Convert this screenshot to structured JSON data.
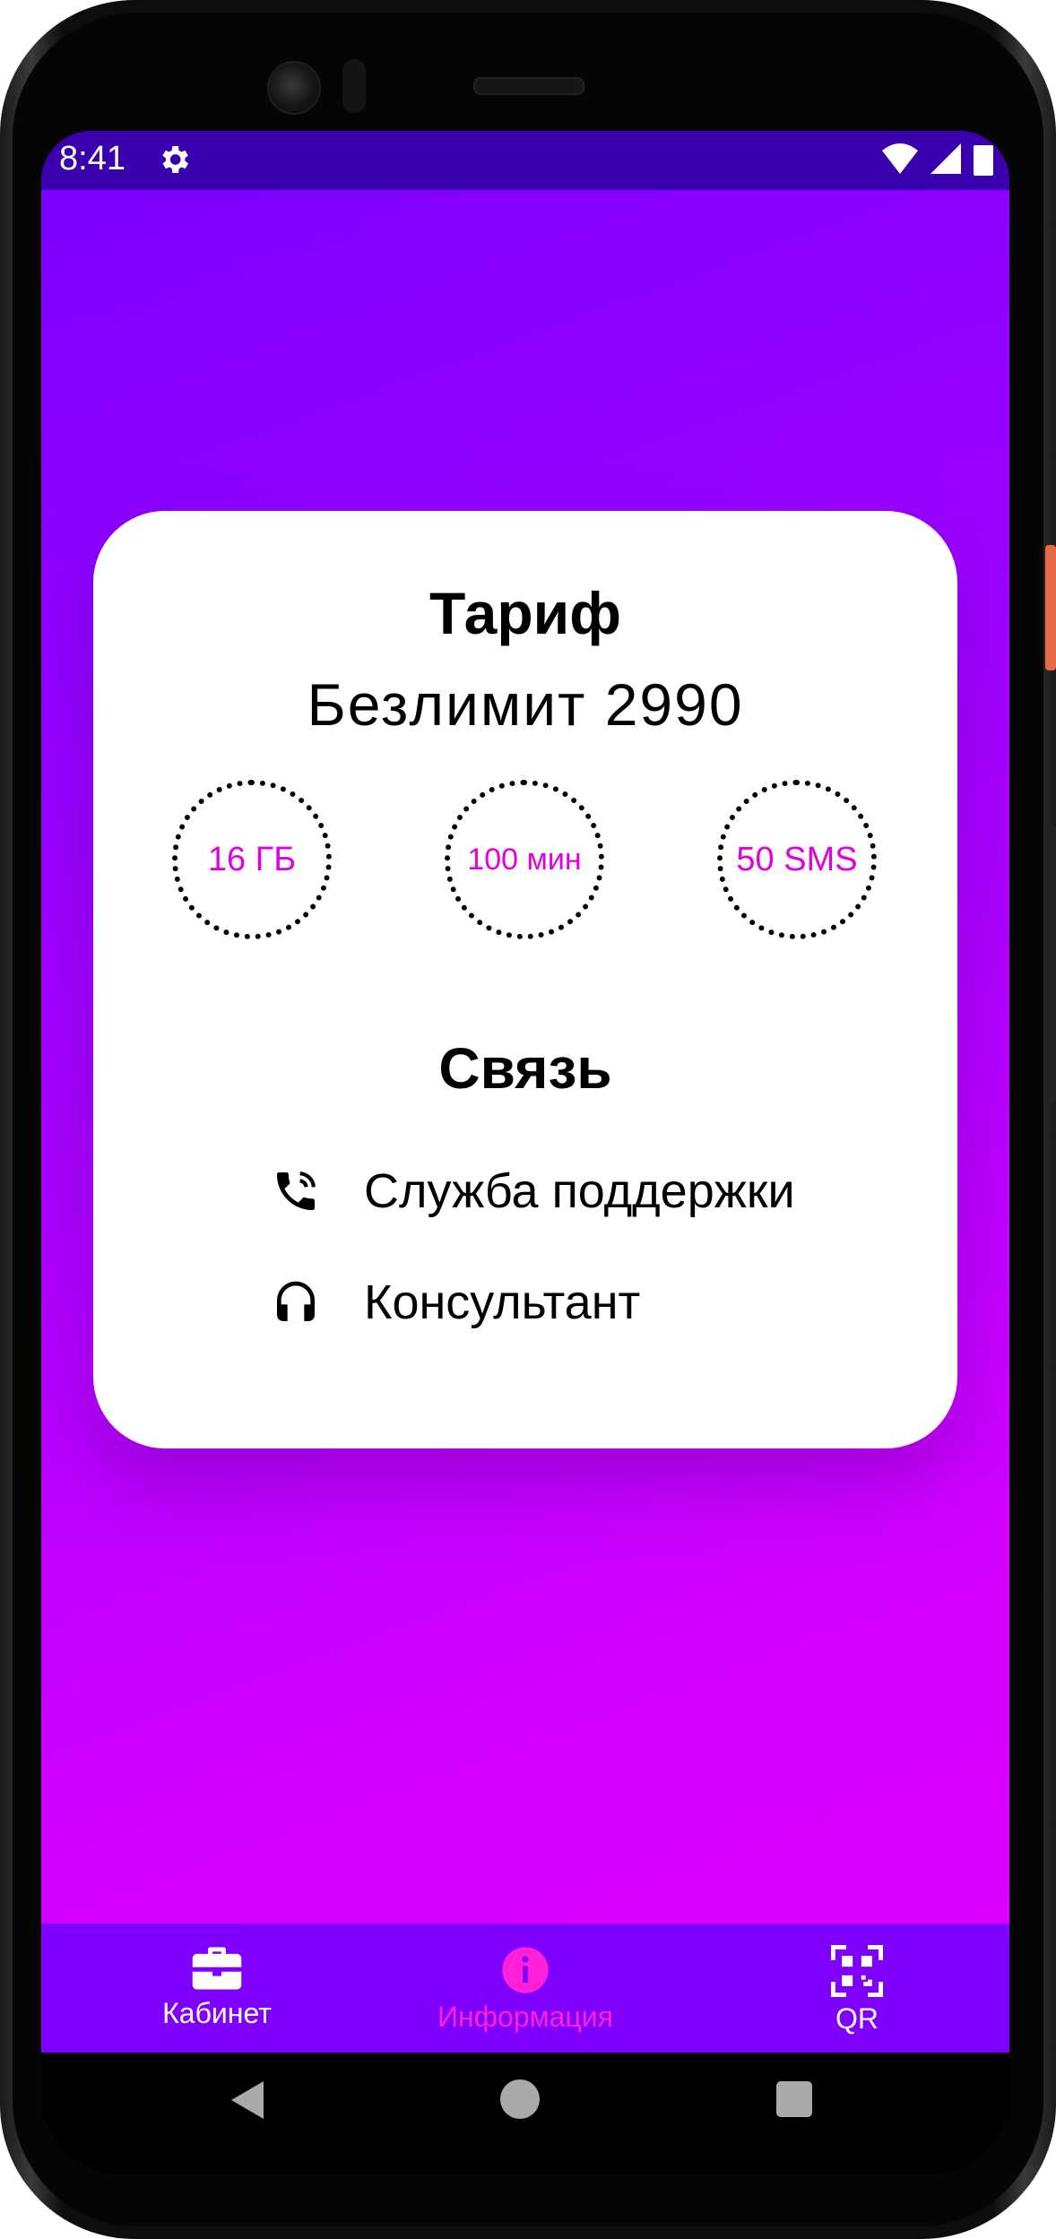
{
  "status_bar": {
    "time": "8:41",
    "icons": [
      "gear-icon",
      "wifi-icon",
      "signal-icon",
      "battery-icon"
    ]
  },
  "card": {
    "title": "Тариф",
    "plan_name": "Безлимит 2990",
    "allowances": [
      "16 ГБ",
      "100 мин",
      "50 SMS"
    ],
    "section_title": "Связь",
    "links": [
      {
        "icon": "phone-ringing-icon",
        "label": "Служба поддержки"
      },
      {
        "icon": "headphones-icon",
        "label": "Консультант"
      }
    ]
  },
  "bottom_nav": {
    "items": [
      {
        "icon": "briefcase-icon",
        "label": "Кабинет",
        "active": false
      },
      {
        "icon": "info-icon",
        "label": "Информация",
        "active": true
      },
      {
        "icon": "qr-code-icon",
        "label": "QR",
        "active": false
      }
    ]
  },
  "colors": {
    "accent": "#e000e0",
    "active_nav": "#ff20d8",
    "nav_background": "#8000ff",
    "status_bar": "#3a00b0"
  }
}
